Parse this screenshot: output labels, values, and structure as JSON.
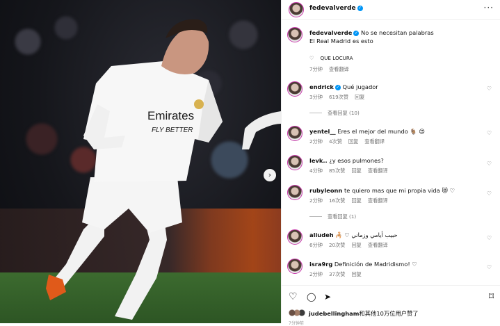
{
  "post": {
    "author": "fedevalverde",
    "caption_line1": "No se necesitan palabras",
    "caption_line2": "El Real Madrid es esto",
    "inner_comment": "QUE LOCURA",
    "inner_time": "7分钟",
    "inner_translate": "查看翻译",
    "shirt_text": "Emirates",
    "shirt_sub": "FLY BETTER",
    "next_icon": "›"
  },
  "header": {
    "username": "fedevalverde",
    "more_label": "···"
  },
  "comments": [
    {
      "user": "endrick",
      "verified": true,
      "text": "Qué jugador",
      "time": "3分钟",
      "likes": "619次赞",
      "reply": "回复",
      "replies_label": "查看回复 (10)"
    },
    {
      "user": "yentel__",
      "verified": false,
      "text": "Eres el mejor del mundo 🐐 😍",
      "time": "2分钟",
      "likes": "4次赞",
      "reply": "回复",
      "translate": "查看翻译"
    },
    {
      "user": "levk..",
      "verified": false,
      "text": "¿y esos pulmones?",
      "time": "4分钟",
      "likes": "85次赞",
      "reply": "回复",
      "translate": "查看翻译"
    },
    {
      "user": "rubyleonn",
      "verified": false,
      "text": "te quiero mas que mi propia vida 😻 ♡",
      "time": "2分钟",
      "likes": "16次赞",
      "reply": "回复",
      "translate": "查看翻译",
      "replies_label": "查看回复 (1)"
    },
    {
      "user": "aliudeh",
      "verified": false,
      "text": "🦂 ♡ حبيب أيامي وزماني",
      "time": "6分钟",
      "likes": "20次赞",
      "reply": "回复",
      "translate": "查看翻译"
    },
    {
      "user": "isra9rg",
      "verified": false,
      "text": "Definición de Madridismo! ♡",
      "time": "2分钟",
      "likes": "37次赞",
      "reply": "回复"
    }
  ],
  "actions": {
    "like_icon": "♡",
    "comment_icon": "◯",
    "share_icon": "➤",
    "save_icon": "⌑"
  },
  "likes": {
    "user": "judebellingham",
    "rest": "和其他10万位用户赞了"
  },
  "time_ago": "7分钟前",
  "colors": {
    "verified": "#0095f6",
    "story_ring": "#c837ab"
  }
}
